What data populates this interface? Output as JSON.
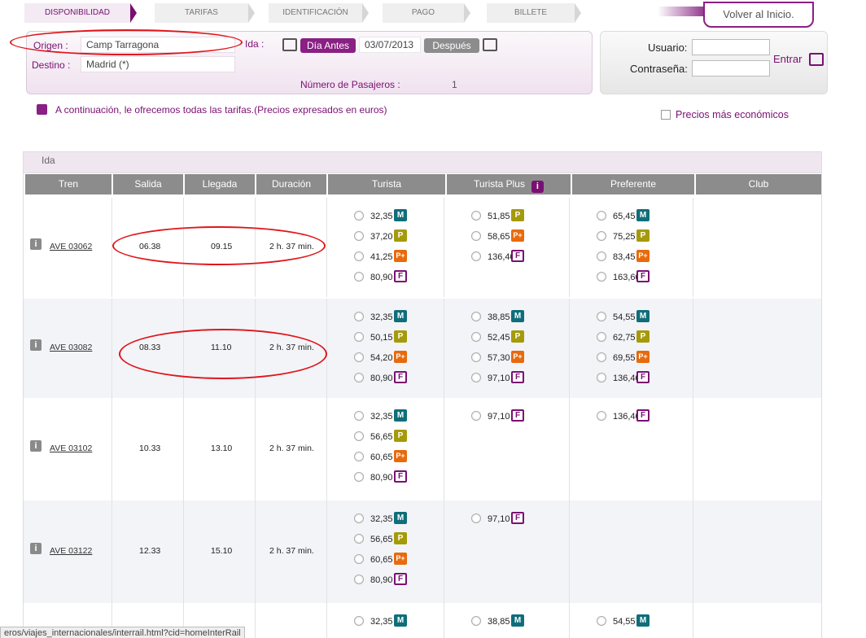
{
  "steps": [
    "DISPONIBILIDAD",
    "TARIFAS",
    "IDENTIFICACIÓN",
    "PAGO",
    "BILLETE"
  ],
  "home_button": "Volver al Inicio.",
  "search": {
    "origen_label": "Origen :",
    "origen_value": "Camp Tarragona",
    "destino_label": "Destino :",
    "destino_value": "Madrid (*)",
    "ida_label": "Ida :",
    "prev_day": "Día Antes",
    "date": "03/07/2013",
    "next_day": "Después",
    "passengers_label": "Número de Pasajeros :",
    "passengers_value": "1"
  },
  "login": {
    "user_label": "Usuario:",
    "password_label": "Contraseña:",
    "submit": "Entrar"
  },
  "notice": "A continuación, le ofrecemos todas las tarifas.(Precios expresados en euros)",
  "cheapest_label": "Precios más económicos",
  "section_label": "Ida",
  "columns": [
    "Tren",
    "Salida",
    "Llegada",
    "Duración",
    "Turista",
    "Turista Plus",
    "Preferente",
    "Club"
  ],
  "turista_plus_info": "i",
  "trains": [
    {
      "train": "AVE 03062",
      "salida": "06.38",
      "llegada": "09.15",
      "duracion": "2 h. 37 min.",
      "turista": [
        [
          "32,35",
          "M"
        ],
        [
          "37,20",
          "P"
        ],
        [
          "41,25",
          "P+"
        ],
        [
          "80,90",
          "F"
        ]
      ],
      "turista_plus": [
        [
          "51,85",
          "P"
        ],
        [
          "58,65",
          "P+"
        ],
        [
          "136,40",
          "F"
        ]
      ],
      "preferente": [
        [
          "65,45",
          "M"
        ],
        [
          "75,25",
          "P"
        ],
        [
          "83,45",
          "P+"
        ],
        [
          "163,60",
          "F"
        ]
      ]
    },
    {
      "train": "AVE 03082",
      "salida": "08.33",
      "llegada": "11.10",
      "duracion": "2 h. 37 min.",
      "turista": [
        [
          "32,35",
          "M"
        ],
        [
          "50,15",
          "P"
        ],
        [
          "54,20",
          "P+"
        ],
        [
          "80,90",
          "F"
        ]
      ],
      "turista_plus": [
        [
          "38,85",
          "M"
        ],
        [
          "52,45",
          "P"
        ],
        [
          "57,30",
          "P+"
        ],
        [
          "97,10",
          "F"
        ]
      ],
      "preferente": [
        [
          "54,55",
          "M"
        ],
        [
          "62,75",
          "P"
        ],
        [
          "69,55",
          "P+"
        ],
        [
          "136,40",
          "F"
        ]
      ]
    },
    {
      "train": "AVE 03102",
      "salida": "10.33",
      "llegada": "13.10",
      "duracion": "2 h. 37 min.",
      "turista": [
        [
          "32,35",
          "M"
        ],
        [
          "56,65",
          "P"
        ],
        [
          "60,65",
          "P+"
        ],
        [
          "80,90",
          "F"
        ]
      ],
      "turista_plus": [
        [
          "97,10",
          "F"
        ]
      ],
      "preferente": [
        [
          "136,40",
          "F"
        ]
      ]
    },
    {
      "train": "AVE 03122",
      "salida": "12.33",
      "llegada": "15.10",
      "duracion": "2 h. 37 min.",
      "turista": [
        [
          "32,35",
          "M"
        ],
        [
          "56,65",
          "P"
        ],
        [
          "60,65",
          "P+"
        ],
        [
          "80,90",
          "F"
        ]
      ],
      "turista_plus": [
        [
          "97,10",
          "F"
        ]
      ],
      "preferente": []
    },
    {
      "train": "",
      "salida": "",
      "llegada": "",
      "duracion": "",
      "turista": [
        [
          "32,35",
          "M"
        ]
      ],
      "turista_plus": [
        [
          "38,85",
          "M"
        ]
      ],
      "preferente": [
        [
          "54,55",
          "M"
        ]
      ]
    }
  ],
  "status_url": "eros/viajes_internacionales/interrail.html?cid=homeInterRail",
  "colors": {
    "accent": "#7a0f72",
    "annotation": "#e0161a",
    "badge_M": "#0f6e7a",
    "badge_P": "#a59a0a",
    "badge_Pplus": "#e86a0c"
  }
}
